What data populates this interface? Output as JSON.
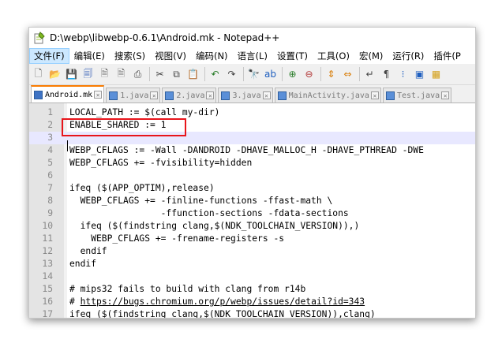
{
  "window": {
    "title": "D:\\webp\\libwebp-0.6.1\\Android.mk - Notepad++"
  },
  "menu": [
    {
      "label": "文件(F)",
      "active": true
    },
    {
      "label": "编辑(E)"
    },
    {
      "label": "搜索(S)"
    },
    {
      "label": "视图(V)"
    },
    {
      "label": "编码(N)"
    },
    {
      "label": "语言(L)"
    },
    {
      "label": "设置(T)"
    },
    {
      "label": "工具(O)"
    },
    {
      "label": "宏(M)"
    },
    {
      "label": "运行(R)"
    },
    {
      "label": "插件(P"
    }
  ],
  "toolbar": [
    {
      "name": "new-file-icon",
      "glyph": "🗋",
      "color": "#4a4a4a"
    },
    {
      "name": "open-file-icon",
      "glyph": "📂",
      "color": "#d4a017"
    },
    {
      "name": "save-icon",
      "glyph": "💾",
      "color": "#3a63b8"
    },
    {
      "name": "save-all-icon",
      "glyph": "🗐",
      "color": "#3a63b8"
    },
    {
      "name": "close-icon",
      "glyph": "🗎",
      "color": "#6a6a6a"
    },
    {
      "name": "close-all-icon",
      "glyph": "🗎",
      "color": "#6a6a6a"
    },
    {
      "name": "print-icon",
      "glyph": "⎙",
      "color": "#444"
    },
    {
      "sep": true
    },
    {
      "name": "cut-icon",
      "glyph": "✂",
      "color": "#444"
    },
    {
      "name": "copy-icon",
      "glyph": "⧉",
      "color": "#444"
    },
    {
      "name": "paste-icon",
      "glyph": "📋",
      "color": "#8a6d3b"
    },
    {
      "sep": true
    },
    {
      "name": "undo-icon",
      "glyph": "↶",
      "color": "#2a7d2a"
    },
    {
      "name": "redo-icon",
      "glyph": "↷",
      "color": "#444"
    },
    {
      "sep": true
    },
    {
      "name": "find-icon",
      "glyph": "🔭",
      "color": "#333"
    },
    {
      "name": "replace-icon",
      "glyph": "ab",
      "color": "#1f5fbf"
    },
    {
      "sep": true
    },
    {
      "name": "zoom-in-icon",
      "glyph": "⊕",
      "color": "#2a7d2a"
    },
    {
      "name": "zoom-out-icon",
      "glyph": "⊖",
      "color": "#b03030"
    },
    {
      "sep": true
    },
    {
      "name": "sync-vertical-icon",
      "glyph": "⇕",
      "color": "#d87a00"
    },
    {
      "name": "sync-horizontal-icon",
      "glyph": "⇔",
      "color": "#d87a00"
    },
    {
      "sep": true
    },
    {
      "name": "word-wrap-icon",
      "glyph": "↵",
      "color": "#444"
    },
    {
      "name": "show-all-chars-icon",
      "glyph": "¶",
      "color": "#444"
    },
    {
      "name": "indent-guide-icon",
      "glyph": "⁝",
      "color": "#1f5fbf"
    },
    {
      "name": "doc-map-icon",
      "glyph": "▣",
      "color": "#1f5fbf"
    },
    {
      "name": "function-list-icon",
      "glyph": "▦",
      "color": "#d4a017"
    }
  ],
  "tabs": [
    {
      "label": "Android.mk",
      "active": true
    },
    {
      "label": "1.java"
    },
    {
      "label": "2.java"
    },
    {
      "label": "3.java"
    },
    {
      "label": "MainActivity.java"
    },
    {
      "label": "Test.java"
    }
  ],
  "lines": [
    {
      "num": "1",
      "text": "LOCAL_PATH := $(call my-dir)"
    },
    {
      "num": "2",
      "text": "ENABLE_SHARED := 1"
    },
    {
      "num": "3",
      "text": "",
      "current": true
    },
    {
      "num": "4",
      "text": "WEBP_CFLAGS := -Wall -DANDROID -DHAVE_MALLOC_H -DHAVE_PTHREAD -DWE"
    },
    {
      "num": "5",
      "text": "WEBP_CFLAGS += -fvisibility=hidden"
    },
    {
      "num": "6",
      "text": ""
    },
    {
      "num": "7",
      "text": "ifeq ($(APP_OPTIM),release)"
    },
    {
      "num": "8",
      "text": "  WEBP_CFLAGS += -finline-functions -ffast-math \\"
    },
    {
      "num": "9",
      "text": "                 -ffunction-sections -fdata-sections"
    },
    {
      "num": "10",
      "text": "  ifeq ($(findstring clang,$(NDK_TOOLCHAIN_VERSION)),)"
    },
    {
      "num": "11",
      "text": "    WEBP_CFLAGS += -frename-registers -s"
    },
    {
      "num": "12",
      "text": "  endif"
    },
    {
      "num": "13",
      "text": "endif"
    },
    {
      "num": "14",
      "text": ""
    },
    {
      "num": "15",
      "text": "# mips32 fails to build with clang from r14b"
    },
    {
      "num": "16",
      "text": "# ",
      "link": "https://bugs.chromium.org/p/webp/issues/detail?id=343"
    },
    {
      "num": "17",
      "text": "ifeq ($(findstring clang,$(NDK_TOOLCHAIN_VERSION)),clang)"
    }
  ],
  "colors": {
    "highlight_box": "#e8151b",
    "active_tab_accent": "#fa7c00",
    "current_line": "#e8e8ff"
  }
}
